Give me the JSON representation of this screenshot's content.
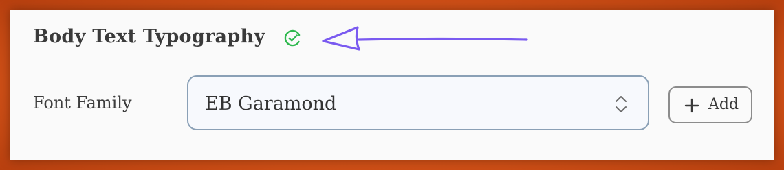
{
  "section": {
    "title": "Body Text Typography",
    "status_icon": "check-circle-icon",
    "status_color": "#2eb84e"
  },
  "annotation": {
    "type": "hand-drawn-arrow",
    "color": "#7a5af0"
  },
  "font_family": {
    "label": "Font Family",
    "selected_value": "EB Garamond",
    "select_icon": "chevron-up-down-icon"
  },
  "add_button": {
    "icon": "plus-icon",
    "label": "Add"
  },
  "colors": {
    "background": "#e0601c",
    "panel": "#fafafa",
    "select_border": "#8aa0b6",
    "select_fill": "#f7f9fd",
    "button_border": "#8c8c8c"
  }
}
